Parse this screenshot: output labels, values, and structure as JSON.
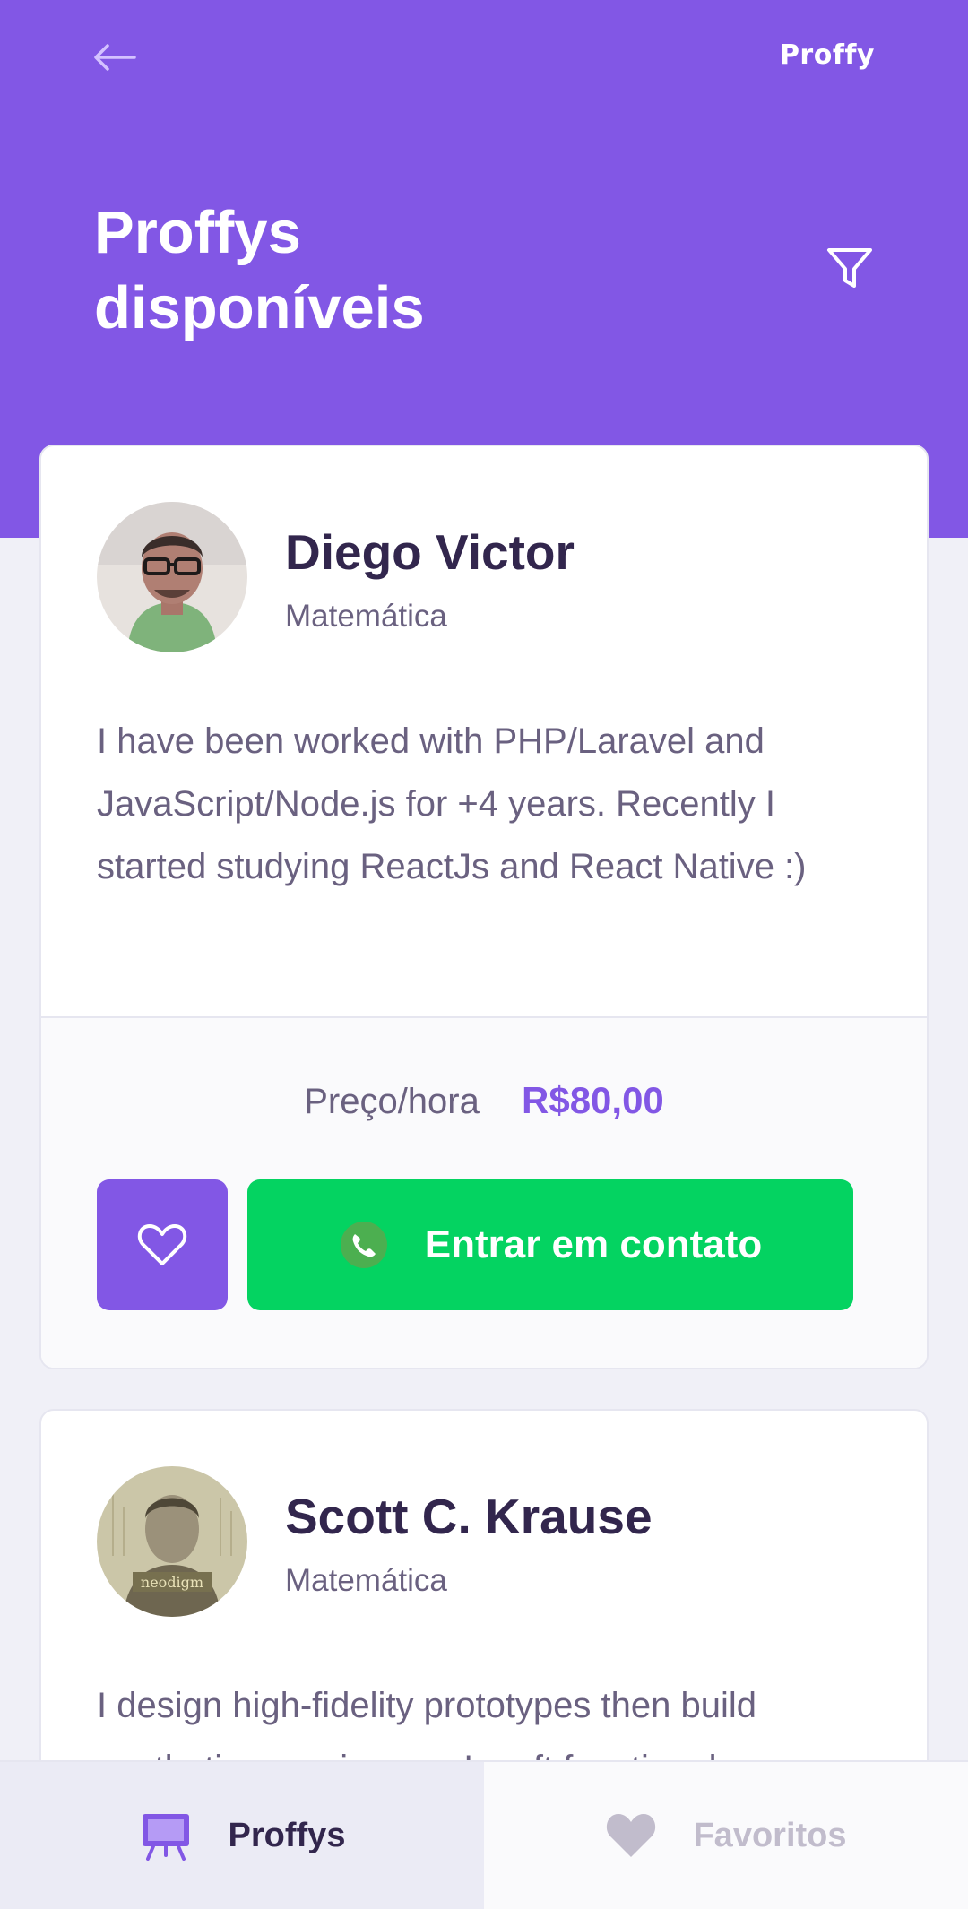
{
  "header": {
    "logo": "Proffy",
    "title_line1": "Proffys",
    "title_line2": "disponíveis",
    "back_icon": "arrow-left-icon",
    "filter_icon": "filter-icon"
  },
  "teachers": [
    {
      "name": "Diego Victor",
      "subject": "Matemática",
      "bio": "I have been worked with PHP/Laravel and JavaScript/Node.js for +4 years. Recently I started studying ReactJs and React Native :)",
      "price_label": "Preço/hora",
      "price_value": "R$80,00",
      "contact_label": "Entrar em contato"
    },
    {
      "name": "Scott C. Krause",
      "subject": "Matemática",
      "bio": "I design high-fidelity prototypes then build aesthetic experiences. I craft functional",
      "avatar_text": "neodigm"
    }
  ],
  "tabs": [
    {
      "label": "Proffys",
      "icon": "easel-icon",
      "active": true
    },
    {
      "label": "Favoritos",
      "icon": "heart-icon",
      "active": false
    }
  ],
  "colors": {
    "primary": "#8257E5",
    "secondary": "#04D361",
    "title": "#32264D",
    "text": "#6A6180",
    "background": "#F0F0F7"
  }
}
